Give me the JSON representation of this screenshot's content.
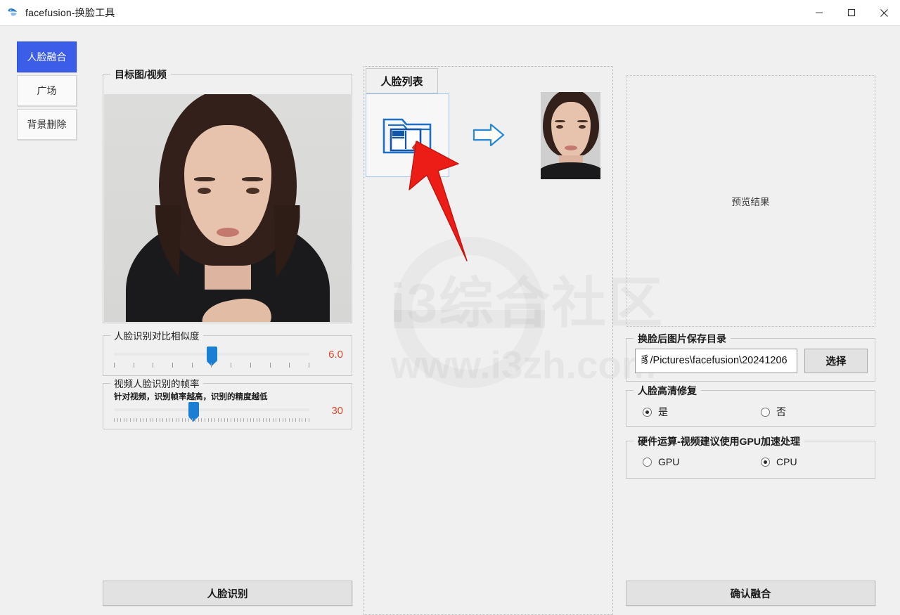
{
  "window": {
    "title": "facefusion-换脸工具",
    "icon": "app-logo-icon",
    "controls": {
      "minimize": "minimize-icon",
      "maximize": "maximize-icon",
      "close": "close-icon"
    }
  },
  "sidebar": {
    "items": [
      {
        "label": "人脸融合",
        "active": true
      },
      {
        "label": "广场",
        "active": false
      },
      {
        "label": "背景删除",
        "active": false
      }
    ]
  },
  "left_panel": {
    "target_group_label": "目标图/视频",
    "similarity": {
      "label": "人脸识别对比相似度",
      "value": "6.0",
      "percent": 50,
      "tick_count": 11
    },
    "fps": {
      "label": "视频人脸识别的帧率",
      "sublabel": "针对视频，识别帧率越高，识别的精度越低",
      "value": "30",
      "percent": 41,
      "tick_count": 61
    },
    "detect_button": "人脸识别"
  },
  "middle_panel": {
    "tab_label": "人脸列表",
    "upload_icon": "folder-upload-icon",
    "flow_icon": "right-arrow-icon",
    "thumbnail": "face-thumbnail",
    "annotation": "red-pointer-arrow"
  },
  "right_panel": {
    "preview_placeholder": "预览结果",
    "save_dir": {
      "label": "换脸后图片保存目录",
      "value": "豸/Pictures\\facefusion\\20241206",
      "button": "选择"
    },
    "hd_restore": {
      "label": "人脸高清修复",
      "options": [
        {
          "label": "是",
          "selected": true
        },
        {
          "label": "否",
          "selected": false
        }
      ]
    },
    "hardware": {
      "label": "硬件运算-视频建议使用GPU加速处理",
      "options": [
        {
          "label": "GPU",
          "selected": false
        },
        {
          "label": "CPU",
          "selected": true
        }
      ]
    },
    "confirm_button": "确认融合"
  },
  "watermark": {
    "text": "i3综合社区",
    "url": "www.i3zh.com"
  },
  "colors": {
    "accent": "#3b5de7",
    "slider_blue": "#1a7fd4",
    "value_red": "#e04a2f",
    "annotation_red": "#e8201a",
    "icon_blue": "#1f6fc4"
  }
}
